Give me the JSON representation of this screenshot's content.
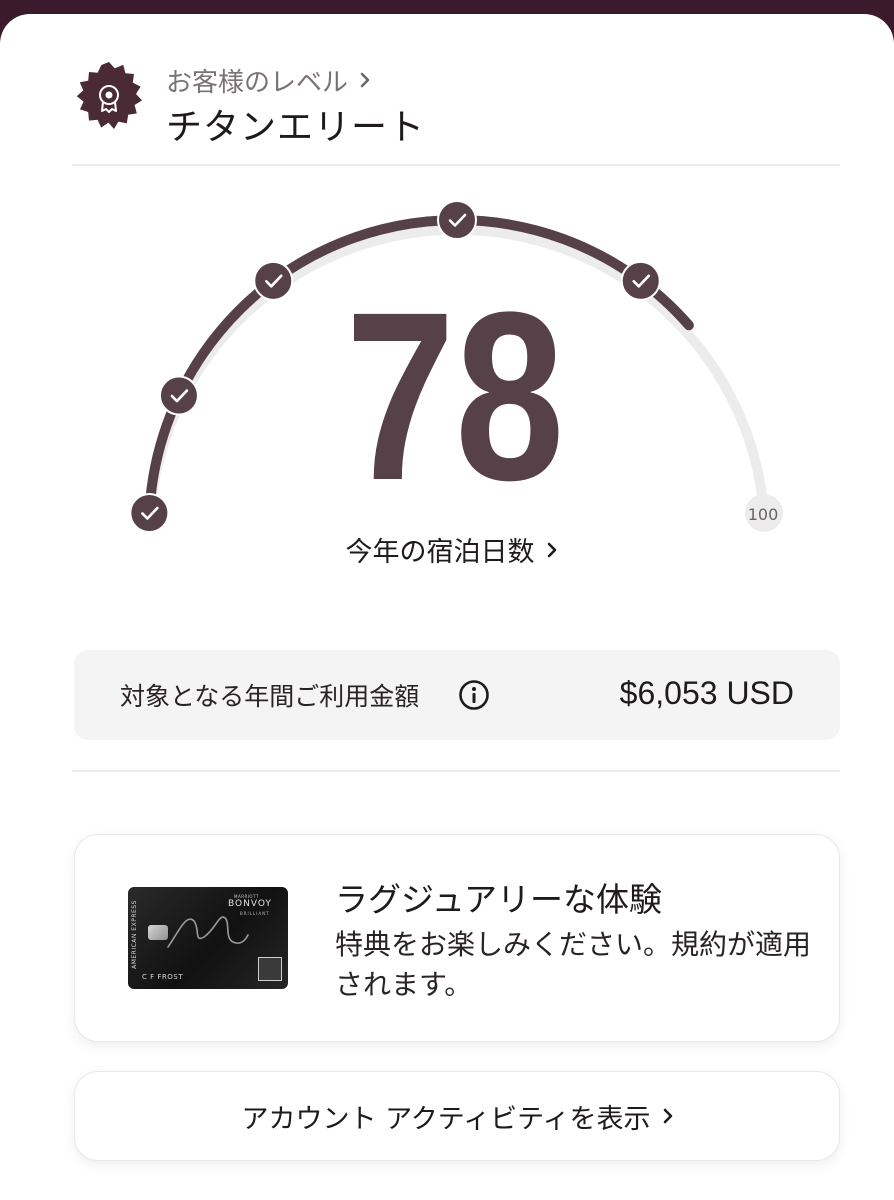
{
  "header": {
    "level_label": "お客様のレベル",
    "level_name": "チタンエリート"
  },
  "gauge": {
    "value": "78",
    "value_number": 78,
    "max_label": "100",
    "max_number": 100,
    "milestones_completed": 5,
    "caption": "今年の宿泊日数"
  },
  "spend": {
    "label": "対象となる年間ご利用金額",
    "value": "$6,053 USD"
  },
  "promo": {
    "title": "ラグジュアリーな体験",
    "body": "特典をお楽しみください。規約が適用されます。",
    "card": {
      "issuer_vertical": "AMERICAN EXPRESS",
      "brand_small": "MARRIOTT",
      "brand": "BONVOY",
      "tier": "BRILLIANT",
      "holder": "C F FROST"
    }
  },
  "activity": {
    "label": "アカウント アクティビティを表示"
  },
  "colors": {
    "brand": "#574148",
    "track": "#ececec",
    "background_top": "#3a1a2b"
  },
  "icons": {
    "badge": "award-badge-icon",
    "chevron": "chevron-right-icon",
    "info": "info-icon",
    "milestone": "check-icon"
  }
}
